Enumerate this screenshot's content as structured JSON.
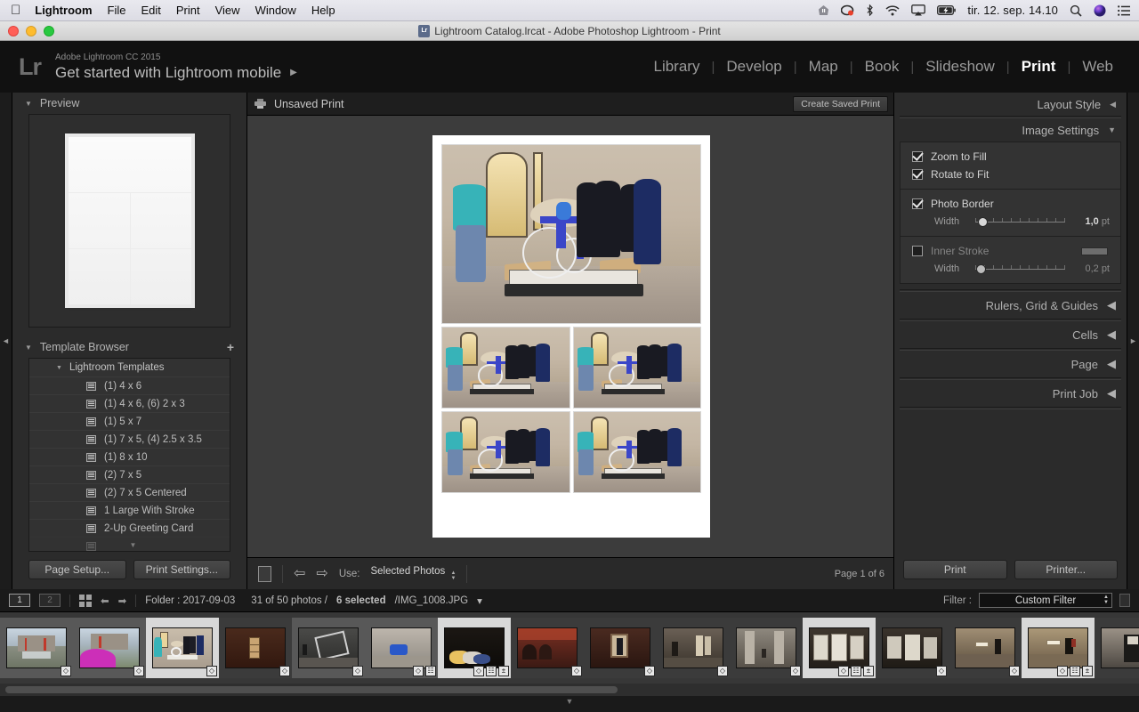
{
  "macos": {
    "apple_logo": "apple-logo",
    "app_name": "Lightroom",
    "menus": [
      "File",
      "Edit",
      "Print",
      "View",
      "Window",
      "Help"
    ],
    "status_icons": [
      "dropbox-icon",
      "recording-icon",
      "bluetooth-icon",
      "wifi-icon",
      "airplay-icon",
      "battery-charging-icon"
    ],
    "clock": "tir. 12. sep.  14.10",
    "search_icon": "search-icon",
    "siri_icon": "siri-icon",
    "notification_icon": "notification-center-icon"
  },
  "window": {
    "title": "Lightroom Catalog.lrcat - Adobe Photoshop Lightroom - Print",
    "doc_icon_label": "Lr"
  },
  "identity": {
    "logo": "Lr",
    "subtitle": "Adobe Lightroom CC 2015",
    "title": "Get started with Lightroom mobile",
    "arrow": "▶"
  },
  "modules": [
    {
      "label": "Library",
      "active": false
    },
    {
      "label": "Develop",
      "active": false
    },
    {
      "label": "Map",
      "active": false
    },
    {
      "label": "Book",
      "active": false
    },
    {
      "label": "Slideshow",
      "active": false
    },
    {
      "label": "Print",
      "active": true
    },
    {
      "label": "Web",
      "active": false
    }
  ],
  "left_panel": {
    "preview": {
      "header": "Preview",
      "triangle": "▼"
    },
    "template_browser": {
      "header": "Template Browser",
      "triangle": "▼",
      "add_label": "+",
      "group": {
        "label": "Lightroom Templates",
        "triangle": "▼"
      },
      "items": [
        "(1) 4 x 6",
        "(1) 4 x 6, (6) 2 x 3",
        "(1) 5 x 7",
        "(1) 7 x 5, (4) 2.5 x 3.5",
        "(1) 8 x 10",
        "(2) 7 x 5",
        "(2) 7 x 5 Centered",
        "1 Large With Stroke",
        "2-Up Greeting Card"
      ]
    },
    "buttons": {
      "page_setup": "Page Setup...",
      "print_settings": "Print Settings..."
    }
  },
  "center": {
    "print_header": {
      "title": "Unsaved Print",
      "icon": "printer-icon",
      "create_button": "Create Saved Print"
    },
    "toolbar": {
      "page_icon": "page-icon",
      "prev_icon": "⇦",
      "next_icon": "⇨",
      "use_label": "Use:",
      "use_value": "Selected Photos",
      "page_indicator": "Page 1 of 6"
    }
  },
  "right_panel": {
    "layout_style": {
      "label": "Layout Style",
      "triangle": "◀"
    },
    "image_settings": {
      "label": "Image Settings",
      "triangle": "▼",
      "zoom_to_fill": {
        "label": "Zoom to Fill",
        "checked": true
      },
      "rotate_to_fit": {
        "label": "Rotate to Fit",
        "checked": true
      },
      "photo_border": {
        "label": "Photo Border",
        "checked": true,
        "width_label": "Width",
        "width_value": "1,0",
        "width_unit": "pt"
      },
      "inner_stroke": {
        "label": "Inner Stroke",
        "checked": false,
        "width_label": "Width",
        "width_value": "0,2",
        "width_unit": "pt",
        "color_swatch": "#6d6d6d"
      }
    },
    "collapsed": [
      {
        "label": "Rulers, Grid & Guides",
        "triangle": "◀"
      },
      {
        "label": "Cells",
        "triangle": "◀"
      },
      {
        "label": "Page",
        "triangle": "◀"
      },
      {
        "label": "Print Job",
        "triangle": "◀"
      }
    ],
    "buttons": {
      "print": "Print",
      "printer": "Printer..."
    }
  },
  "filmstrip_bar": {
    "screen1": "1",
    "screen2": "2",
    "grid_icon": "grid-view-icon",
    "prev_icon": "⬅",
    "next_icon": "➡",
    "folder_label": "Folder : 2017-09-03",
    "photo_count": "31 of 50 photos /",
    "selected_count": "6 selected",
    "filename": "/IMG_1008.JPG",
    "filename_caret": "▾",
    "filter_label": "Filter :",
    "filter_value": "Custom Filter",
    "lock_icon": "filter-lock-icon"
  },
  "filmstrip_thumbs": [
    {
      "name": "fountain-monument",
      "state": "normal",
      "badges": [
        "crop"
      ],
      "scene": "fountain"
    },
    {
      "name": "fountain-flower",
      "state": "normal",
      "badges": [
        "crop"
      ],
      "scene": "flower"
    },
    {
      "name": "museum-wheelchair",
      "state": "selected",
      "badges": [
        "crop"
      ],
      "scene": "museum"
    },
    {
      "name": "wood-panel",
      "state": "dark",
      "badges": [
        "crop"
      ],
      "scene": "wood"
    },
    {
      "name": "gallery-frame",
      "state": "normal",
      "badges": [
        "crop"
      ],
      "scene": "frame"
    },
    {
      "name": "blue-object",
      "state": "normal",
      "badges": [
        "crop",
        "grid"
      ],
      "scene": "blueobj"
    },
    {
      "name": "laundry-pile",
      "state": "selected",
      "badges": [
        "crop",
        "grid",
        "edit"
      ],
      "scene": "pile"
    },
    {
      "name": "red-hall",
      "state": "dark",
      "badges": [
        "crop"
      ],
      "scene": "redhall"
    },
    {
      "name": "portrait-painting",
      "state": "dark",
      "badges": [
        "crop"
      ],
      "scene": "portrait"
    },
    {
      "name": "statue-room",
      "state": "dark",
      "badges": [
        "crop"
      ],
      "scene": "statue"
    },
    {
      "name": "columns-hall",
      "state": "dark",
      "badges": [
        "crop"
      ],
      "scene": "columns"
    },
    {
      "name": "drawings-wall",
      "state": "selected",
      "badges": [
        "crop",
        "grid",
        "edit"
      ],
      "scene": "drawings"
    },
    {
      "name": "papers-wall",
      "state": "dark",
      "badges": [
        "crop"
      ],
      "scene": "papers"
    },
    {
      "name": "corridor-visitor",
      "state": "dark",
      "badges": [
        "crop"
      ],
      "scene": "corridor"
    },
    {
      "name": "corridor-selected",
      "state": "selected",
      "badges": [
        "crop",
        "grid",
        "edit"
      ],
      "scene": "corridor2"
    },
    {
      "name": "person-artwork",
      "state": "dark",
      "badges": [
        "crop"
      ],
      "scene": "person"
    },
    {
      "name": "frames-row",
      "state": "dark",
      "badges": [
        "crop"
      ],
      "scene": "frames"
    }
  ],
  "print_layout": {
    "cells": [
      {
        "name": "large-photo",
        "size": "large"
      },
      {
        "name": "small-photo-1",
        "size": "small"
      },
      {
        "name": "small-photo-2",
        "size": "small"
      },
      {
        "name": "small-photo-3",
        "size": "small"
      },
      {
        "name": "small-photo-4",
        "size": "small"
      }
    ]
  },
  "colors": {
    "panel_bg": "#2b2b2b",
    "canvas_bg": "#3c3c3c",
    "accent_text": "#ffffff",
    "dim_text": "#9a9a9a"
  }
}
